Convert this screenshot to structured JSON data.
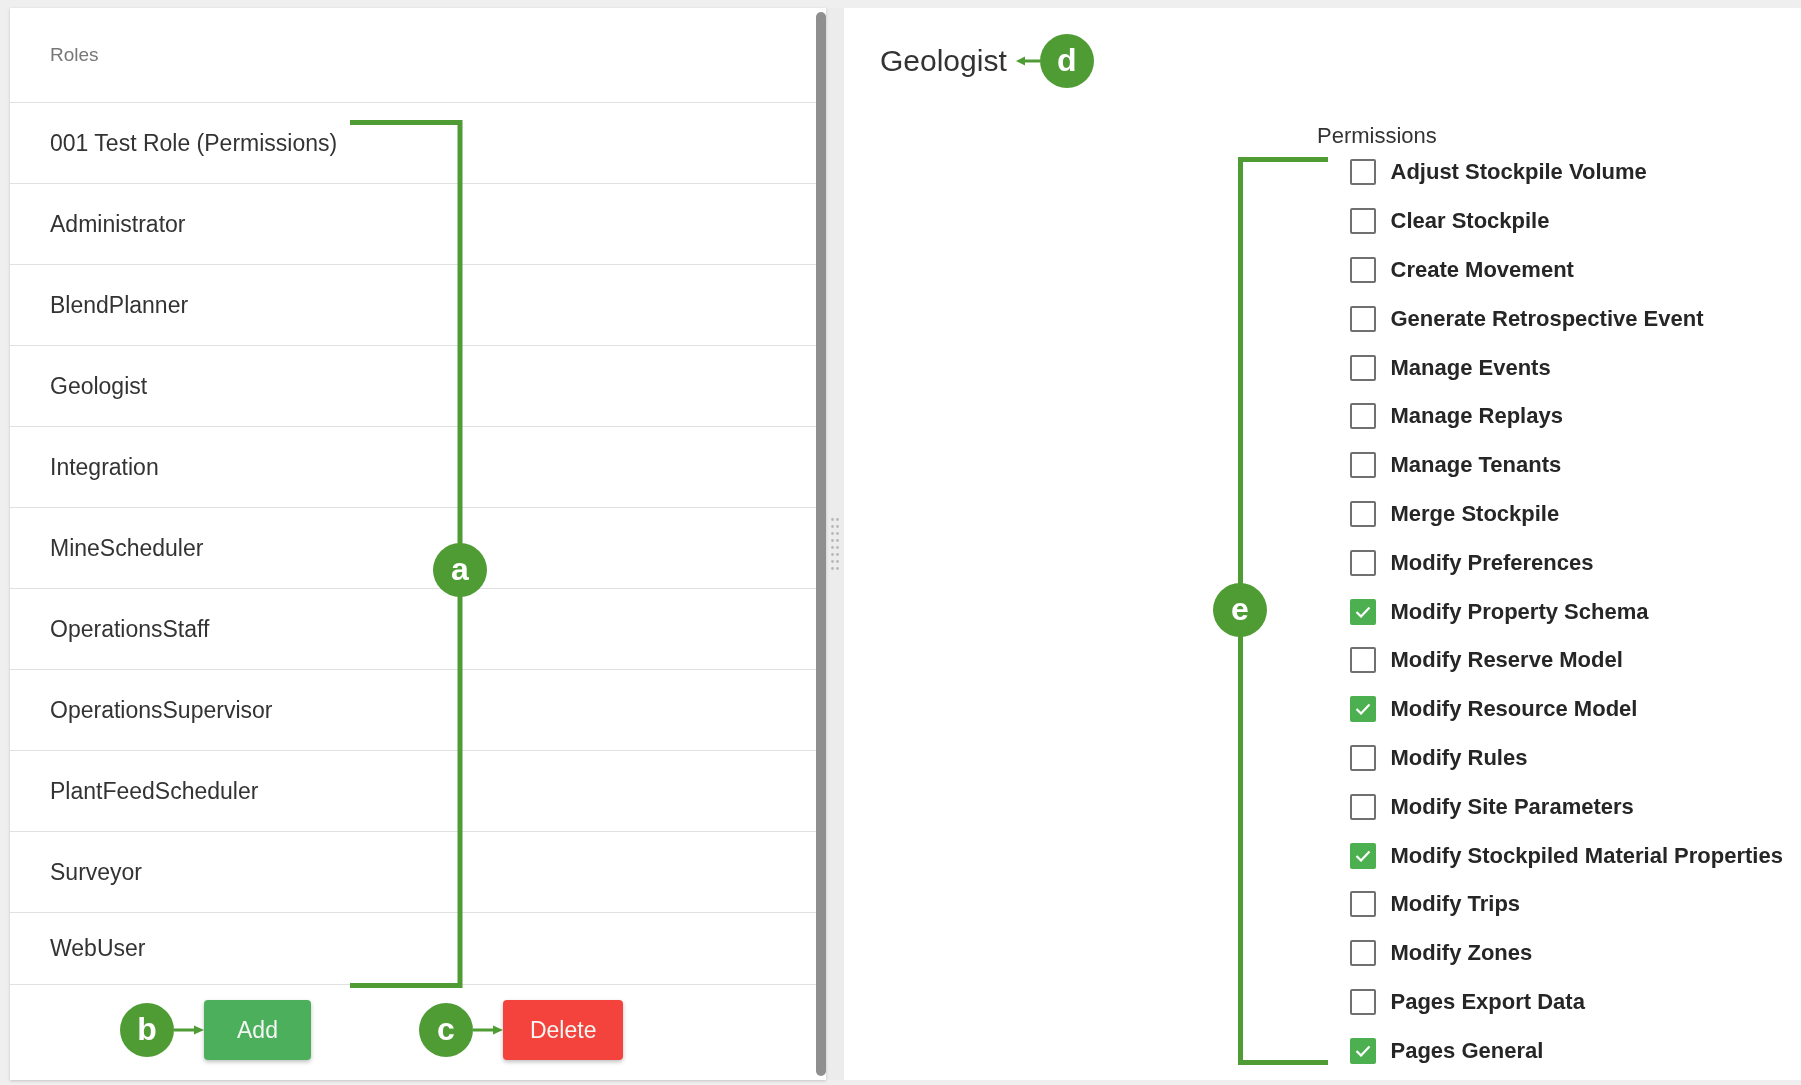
{
  "roles_panel": {
    "header": "Roles",
    "roles": [
      {
        "name": "001 Test Role (Permissions)",
        "selected": false
      },
      {
        "name": "Administrator",
        "selected": false
      },
      {
        "name": "BlendPlanner",
        "selected": false
      },
      {
        "name": "Geologist",
        "selected": false
      },
      {
        "name": "Integration",
        "selected": false
      },
      {
        "name": "MineScheduler",
        "selected": false
      },
      {
        "name": "OperationsStaff",
        "selected": false
      },
      {
        "name": "OperationsSupervisor",
        "selected": false
      },
      {
        "name": "PlantFeedScheduler",
        "selected": false
      },
      {
        "name": "Surveyor",
        "selected": false
      },
      {
        "name": "WebUser",
        "selected": false
      }
    ],
    "callout": {
      "label": "a"
    },
    "actions": [
      {
        "label": "Add",
        "kind": "add",
        "callout": {
          "label": "b"
        }
      },
      {
        "label": "Delete",
        "kind": "delete",
        "callout": {
          "label": "c"
        }
      }
    ]
  },
  "role_detail": {
    "title": "Geologist",
    "title_callout": {
      "label": "d"
    },
    "permissions_heading": "Permissions",
    "permissions_callout": {
      "label": "e"
    },
    "permissions": [
      {
        "label": "Adjust Stockpile Volume",
        "checked": false
      },
      {
        "label": "Clear Stockpile",
        "checked": false
      },
      {
        "label": "Create Movement",
        "checked": false
      },
      {
        "label": "Generate Retrospective Event",
        "checked": false
      },
      {
        "label": "Manage Events",
        "checked": false
      },
      {
        "label": "Manage Replays",
        "checked": false
      },
      {
        "label": "Manage Tenants",
        "checked": false
      },
      {
        "label": "Merge Stockpile",
        "checked": false
      },
      {
        "label": "Modify Preferences",
        "checked": false
      },
      {
        "label": "Modify Property Schema",
        "checked": true
      },
      {
        "label": "Modify Reserve Model",
        "checked": false
      },
      {
        "label": "Modify Resource Model",
        "checked": true
      },
      {
        "label": "Modify Rules",
        "checked": false
      },
      {
        "label": "Modify Site Parameters",
        "checked": false
      },
      {
        "label": "Modify Stockpiled Material Properties",
        "checked": true
      },
      {
        "label": "Modify Trips",
        "checked": false
      },
      {
        "label": "Modify Zones",
        "checked": false
      },
      {
        "label": "Pages Export Data",
        "checked": false
      },
      {
        "label": "Pages General",
        "checked": true
      }
    ]
  }
}
